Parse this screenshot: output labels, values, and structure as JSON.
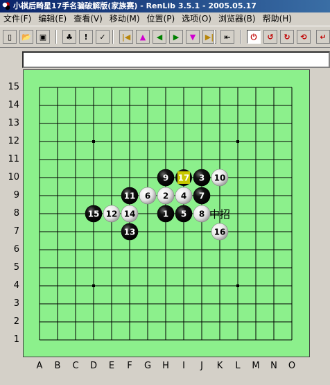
{
  "window": {
    "title": "小棋后畸星17手名骗破解版(家族赛) - RenLib 3.5.1 - 2005.05.17"
  },
  "menu": [
    "文件(F)",
    "编辑(E)",
    "查看(V)",
    "移动(M)",
    "位置(P)",
    "选项(O)",
    "浏览器(B)",
    "帮助(H)"
  ],
  "toolbar": {
    "buttons": [
      {
        "name": "new-icon",
        "glyph": "▯"
      },
      {
        "name": "open-icon",
        "glyph": "📂"
      },
      {
        "name": "save-icon",
        "glyph": "▣"
      },
      {
        "name": "tree-icon",
        "glyph": "♣"
      },
      {
        "name": "warning-icon",
        "glyph": "!"
      },
      {
        "name": "check-icon",
        "glyph": "✓"
      },
      {
        "name": "first-move-icon",
        "glyph": "|◀"
      },
      {
        "name": "up-icon",
        "glyph": "▲"
      },
      {
        "name": "back-icon",
        "glyph": "◀"
      },
      {
        "name": "forward-icon",
        "glyph": "▶"
      },
      {
        "name": "down-icon",
        "glyph": "▼"
      },
      {
        "name": "last-move-icon",
        "glyph": "▶|"
      },
      {
        "name": "jump-icon",
        "glyph": "⇤"
      },
      {
        "name": "power-icon",
        "glyph": "⏻"
      },
      {
        "name": "rotate-left-icon",
        "glyph": "↺"
      },
      {
        "name": "rotate-right-icon",
        "glyph": "↻"
      },
      {
        "name": "flip-icon",
        "glyph": "⟲"
      },
      {
        "name": "return-icon",
        "glyph": "↵"
      }
    ]
  },
  "board": {
    "rows": [
      "15",
      "14",
      "13",
      "12",
      "11",
      "10",
      "9",
      "8",
      "7",
      "6",
      "5",
      "4",
      "3",
      "2",
      "1"
    ],
    "cols": [
      "A",
      "B",
      "C",
      "D",
      "E",
      "F",
      "G",
      "H",
      "I",
      "J",
      "K",
      "L",
      "M",
      "N",
      "O"
    ],
    "stones": [
      {
        "n": "1",
        "col": "H",
        "row": 8,
        "color": "black"
      },
      {
        "n": "2",
        "col": "H",
        "row": 9,
        "color": "white"
      },
      {
        "n": "3",
        "col": "J",
        "row": 10,
        "color": "black"
      },
      {
        "n": "4",
        "col": "I",
        "row": 9,
        "color": "white"
      },
      {
        "n": "5",
        "col": "I",
        "row": 8,
        "color": "black"
      },
      {
        "n": "6",
        "col": "G",
        "row": 9,
        "color": "white"
      },
      {
        "n": "7",
        "col": "J",
        "row": 9,
        "color": "black"
      },
      {
        "n": "8",
        "col": "J",
        "row": 8,
        "color": "white"
      },
      {
        "n": "9",
        "col": "H",
        "row": 10,
        "color": "black"
      },
      {
        "n": "10",
        "col": "K",
        "row": 10,
        "color": "white"
      },
      {
        "n": "11",
        "col": "F",
        "row": 9,
        "color": "black"
      },
      {
        "n": "12",
        "col": "E",
        "row": 8,
        "color": "white"
      },
      {
        "n": "13",
        "col": "F",
        "row": 7,
        "color": "black"
      },
      {
        "n": "14",
        "col": "F",
        "row": 8,
        "color": "white"
      },
      {
        "n": "15",
        "col": "D",
        "row": 8,
        "color": "black"
      },
      {
        "n": "16",
        "col": "K",
        "row": 7,
        "color": "white"
      },
      {
        "n": "17",
        "col": "I",
        "row": 10,
        "color": "black",
        "last": true
      }
    ],
    "star_points": [
      [
        "D",
        12
      ],
      [
        "L",
        12
      ],
      [
        "D",
        4
      ],
      [
        "L",
        4
      ],
      [
        "H",
        8
      ]
    ],
    "note": {
      "text": "中招",
      "col": "K",
      "row": 8
    }
  },
  "colors": {
    "board": "#8cf08c",
    "last_move": "#c8c800"
  }
}
